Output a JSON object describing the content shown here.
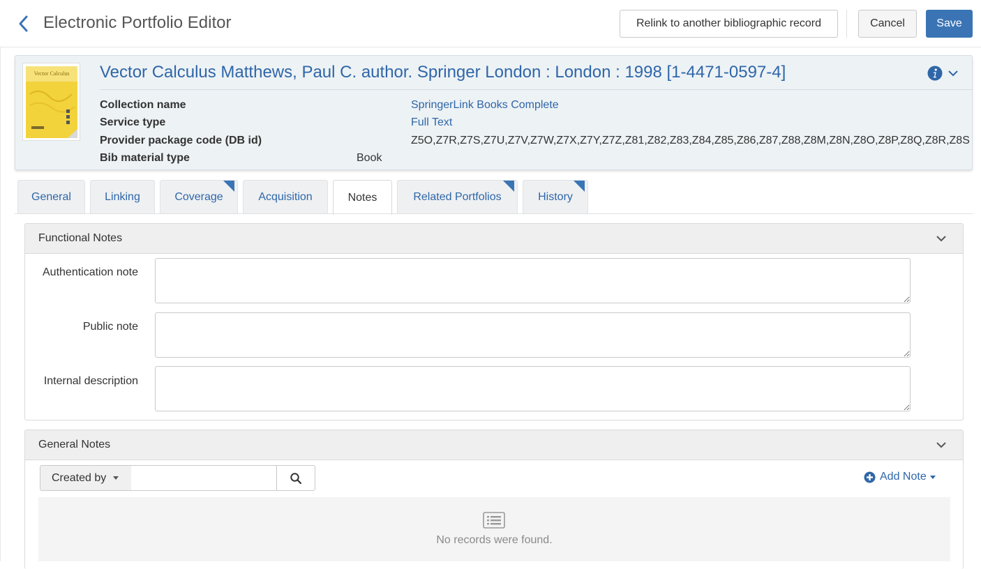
{
  "header": {
    "title": "Electronic Portfolio Editor",
    "relink_label": "Relink to another bibliographic record",
    "cancel_label": "Cancel",
    "save_label": "Save"
  },
  "record": {
    "title": "Vector Calculus Matthews, Paul C. author. Springer London : London : 1998 [1-4471-0597-4]",
    "cover_text": "Vector Calculus",
    "fields": [
      {
        "label": "Collection name",
        "value": "SpringerLink Books Complete"
      },
      {
        "label": "Service type",
        "value": "Full Text"
      },
      {
        "label": "Provider package code (DB id)",
        "value": "Z5O,Z7R,Z7S,Z7U,Z7V,Z7W,Z7X,Z7Y,Z7Z,Z81,Z82,Z83,Z84,Z85,Z86,Z87,Z88,Z8M,Z8N,Z8O,Z8P,Z8Q,Z8R,Z8S"
      },
      {
        "label": "Bib material type",
        "value": "Book"
      }
    ]
  },
  "tabs": [
    {
      "label": "General",
      "flag": false,
      "active": false
    },
    {
      "label": "Linking",
      "flag": false,
      "active": false
    },
    {
      "label": "Coverage",
      "flag": true,
      "active": false
    },
    {
      "label": "Acquisition",
      "flag": false,
      "active": false
    },
    {
      "label": "Notes",
      "flag": false,
      "active": true
    },
    {
      "label": "Related Portfolios",
      "flag": true,
      "active": false
    },
    {
      "label": "History",
      "flag": true,
      "active": false
    }
  ],
  "functional_notes": {
    "title": "Functional Notes",
    "fields": [
      {
        "label": "Authentication note",
        "value": ""
      },
      {
        "label": "Public note",
        "value": ""
      },
      {
        "label": "Internal description",
        "value": ""
      }
    ]
  },
  "general_notes": {
    "title": "General Notes",
    "filter_label": "Created by",
    "search_value": "",
    "add_note_label": "Add Note",
    "empty_text": "No records were found."
  },
  "colors": {
    "link": "#2f66a8",
    "primary_button": "#3a74b5",
    "card_background": "#edf2f5"
  }
}
